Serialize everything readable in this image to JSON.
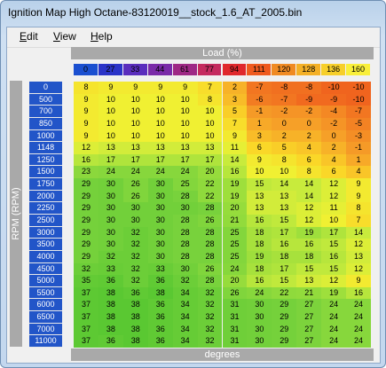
{
  "window": {
    "title": "Ignition Map High Octane-83120019__stock_1.6_AT_2005.bin"
  },
  "menu": {
    "edit": "Edit",
    "view": "View",
    "help": "Help"
  },
  "axes": {
    "load_label": "Load (%)",
    "rpm_label": "RPM (RPM)",
    "value_label": "degrees"
  },
  "load": [
    0,
    27,
    33,
    44,
    61,
    77,
    94,
    111,
    120,
    128,
    136,
    160
  ],
  "rpm": [
    0,
    500,
    700,
    850,
    1000,
    1148,
    1250,
    1500,
    1750,
    2000,
    2250,
    2500,
    3000,
    3500,
    4000,
    4500,
    5000,
    5500,
    6000,
    6500,
    7000,
    11000
  ],
  "table": [
    [
      8,
      9,
      9,
      9,
      9,
      7,
      2,
      -7,
      -8,
      -8,
      -10,
      -10
    ],
    [
      9,
      10,
      10,
      10,
      10,
      8,
      3,
      -6,
      -7,
      -9,
      -9,
      -10
    ],
    [
      9,
      10,
      10,
      10,
      10,
      10,
      5,
      -1,
      -2,
      -2,
      -4,
      -7
    ],
    [
      9,
      10,
      10,
      10,
      10,
      10,
      7,
      1,
      0,
      0,
      -2,
      -5
    ],
    [
      9,
      10,
      10,
      10,
      10,
      10,
      9,
      3,
      2,
      2,
      0,
      -3
    ],
    [
      12,
      13,
      13,
      13,
      13,
      13,
      11,
      6,
      5,
      4,
      2,
      -1
    ],
    [
      16,
      17,
      17,
      17,
      17,
      17,
      14,
      9,
      8,
      6,
      4,
      1
    ],
    [
      23,
      24,
      24,
      24,
      24,
      20,
      16,
      10,
      10,
      8,
      6,
      4
    ],
    [
      29,
      30,
      26,
      30,
      25,
      22,
      19,
      15,
      14,
      14,
      12,
      9
    ],
    [
      29,
      30,
      26,
      30,
      28,
      22,
      19,
      13,
      13,
      14,
      12,
      9
    ],
    [
      29,
      30,
      30,
      30,
      30,
      28,
      20,
      13,
      13,
      12,
      11,
      8
    ],
    [
      29,
      30,
      30,
      30,
      28,
      26,
      21,
      16,
      15,
      12,
      10,
      7
    ],
    [
      29,
      30,
      32,
      30,
      28,
      28,
      25,
      18,
      17,
      19,
      17,
      14
    ],
    [
      29,
      30,
      32,
      30,
      28,
      28,
      25,
      18,
      16,
      16,
      15,
      12
    ],
    [
      29,
      32,
      32,
      30,
      28,
      28,
      25,
      19,
      18,
      18,
      16,
      13
    ],
    [
      32,
      33,
      32,
      33,
      30,
      26,
      24,
      18,
      17,
      15,
      15,
      12
    ],
    [
      35,
      36,
      32,
      36,
      32,
      28,
      20,
      16,
      15,
      13,
      12,
      9
    ],
    [
      37,
      38,
      36,
      38,
      34,
      32,
      26,
      24,
      22,
      21,
      19,
      16
    ],
    [
      37,
      38,
      38,
      36,
      34,
      32,
      31,
      30,
      29,
      27,
      24,
      24
    ],
    [
      37,
      38,
      38,
      36,
      34,
      32,
      31,
      30,
      29,
      27,
      24,
      24
    ],
    [
      37,
      38,
      38,
      36,
      34,
      32,
      31,
      30,
      29,
      27,
      24,
      24
    ],
    [
      37,
      36,
      38,
      36,
      34,
      32,
      31,
      30,
      29,
      27,
      24,
      24
    ]
  ],
  "colors": {
    "load_cells": [
      "#1a4fd0",
      "#2a33c8",
      "#5a2dbd",
      "#7a2aa8",
      "#9e2885",
      "#c42a5e",
      "#e0282c",
      "#ef5a1e",
      "#f08a22",
      "#f4b026",
      "#f7cf2a",
      "#f9ef3a"
    ],
    "rpm_cell": "#2255c8",
    "header_bar": "#a9a9a9"
  }
}
